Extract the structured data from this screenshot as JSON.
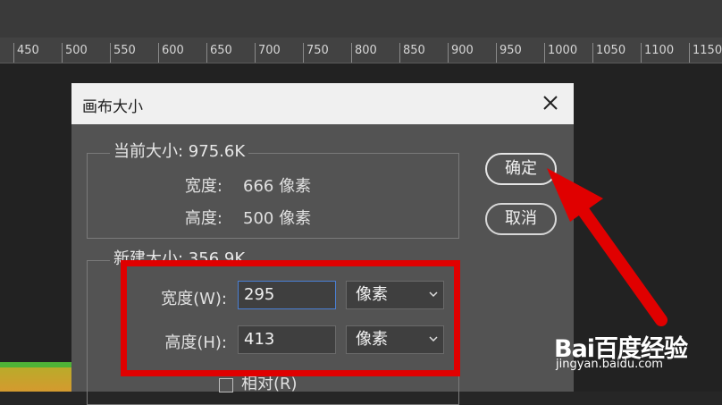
{
  "ruler": {
    "ticks": [
      "450",
      "500",
      "550",
      "600",
      "650",
      "700",
      "750",
      "800",
      "850",
      "900",
      "950",
      "1000",
      "1050",
      "1100",
      "1150"
    ]
  },
  "dialog": {
    "title": "画布大小",
    "current": {
      "legend": "当前大小: 975.6K",
      "width_label": "宽度:",
      "width_value": "666 像素",
      "height_label": "高度:",
      "height_value": "500 像素"
    },
    "new_size": {
      "legend": "新建大小: 356.9K",
      "width_label": "宽度(W):",
      "width_value": "295",
      "width_unit": "像素",
      "height_label": "高度(H):",
      "height_value": "413",
      "height_unit": "像素",
      "relative_label": "相对(R)"
    },
    "ok_label": "确定",
    "cancel_label": "取消"
  },
  "annotations": {
    "highlight_color": "#e00000",
    "arrow_color": "#e00000"
  },
  "watermark": {
    "logo": "Bai百度经验",
    "url": "jingyan.baidu.com"
  }
}
